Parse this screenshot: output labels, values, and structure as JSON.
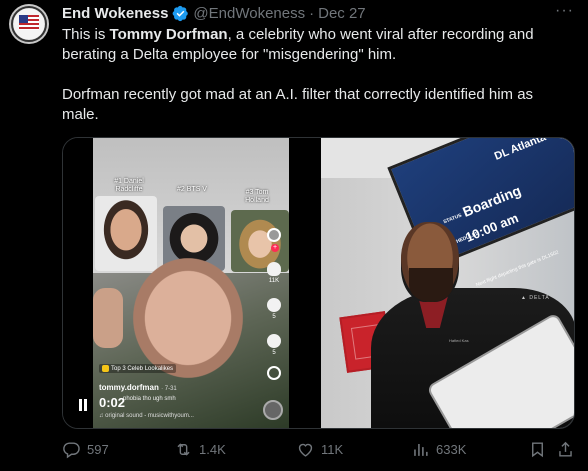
{
  "tweet": {
    "display_name": "End Wokeness",
    "handle": "@EndWokeness",
    "separator": "·",
    "date": "Dec 27",
    "more_label": "···",
    "text": {
      "line1_prefix": "This is ",
      "line1_bold": "Tommy Dorfman",
      "line1_suffix": ", a celebrity who went viral after recording and",
      "line2": "berating a Delta employee for  \"misgendering\" him.",
      "line3": "Dorfman recently got mad at an A.I. filter that correctly identified him as",
      "line4": "male."
    }
  },
  "media": {
    "tiktok": {
      "caption1": "#1 Daniel Radcliffe",
      "caption2": "#2 BTS V",
      "caption3": "#3 Tom Holland",
      "count1": "11K",
      "count2": "5",
      "count3": "5",
      "lookalikes": "Top 3 Celeb Lookalikes",
      "username": "tommy.dorfman",
      "user_date": "· 7-31",
      "caption": "phobia tho ugh smh",
      "sound": "♫ original sound - musicwithyoum...",
      "timecode": "0:02"
    },
    "airport": {
      "board_atlanta": "DL Atlanta",
      "board_status": "STATUS",
      "board_boarding": "Boarding",
      "board_scheduled": "SCHEDULED",
      "board_time": "10:00 am",
      "board_next": "Next flight departing this gate is DL1502",
      "delta_logo": "▲ DELTA",
      "badge": "Hafied Kas"
    }
  },
  "actions": {
    "replies": "597",
    "retweets": "1.4K",
    "likes": "11K",
    "views": "633K"
  },
  "colors": {
    "background": "#000000",
    "text": "#e7e9ea",
    "muted": "#71767b",
    "verified": "#1d9bf0",
    "border": "#2f3336"
  },
  "icons": [
    "verified-badge-icon",
    "more-icon",
    "reply-icon",
    "retweet-icon",
    "like-icon",
    "views-icon",
    "bookmark-icon",
    "share-icon",
    "pause-icon"
  ]
}
